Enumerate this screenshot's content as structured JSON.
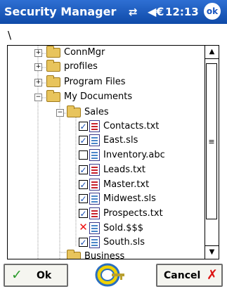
{
  "titlebar": {
    "title": "Security Manager",
    "signal_icon": "signal-icon",
    "volume_icon": "speaker-icon",
    "time": "12:13",
    "ok_label": "ok"
  },
  "path": "\\",
  "tree": {
    "items": [
      {
        "label": "ConnMgr",
        "type": "folder",
        "expander": "+"
      },
      {
        "label": "profiles",
        "type": "folder",
        "expander": "+"
      },
      {
        "label": "Program Files",
        "type": "folder",
        "expander": "+"
      },
      {
        "label": "My Documents",
        "type": "folder",
        "expander": "−"
      },
      {
        "label": "Sales",
        "type": "folder",
        "expander": "−"
      },
      {
        "label": "Contacts.txt",
        "type": "file",
        "check": "checked",
        "icon": "red"
      },
      {
        "label": "East.sls",
        "type": "file",
        "check": "checked",
        "icon": "multi"
      },
      {
        "label": "Inventory.abc",
        "type": "file",
        "check": "unchecked",
        "icon": "blue"
      },
      {
        "label": "Leads.txt",
        "type": "file",
        "check": "checked",
        "icon": "red"
      },
      {
        "label": "Master.txt",
        "type": "file",
        "check": "checked",
        "icon": "red"
      },
      {
        "label": "Midwest.sls",
        "type": "file",
        "check": "checked",
        "icon": "multi"
      },
      {
        "label": "Prospects.txt",
        "type": "file",
        "check": "checked",
        "icon": "red"
      },
      {
        "label": "Sold.$$$",
        "type": "file",
        "check": "denied",
        "icon": "blue"
      },
      {
        "label": "South.sls",
        "type": "file",
        "check": "checked",
        "icon": "multi"
      },
      {
        "label": "Business",
        "type": "folder"
      }
    ],
    "scrollbar": {
      "up_icon": "scroll-up-arrow-icon",
      "down_icon": "scroll-down-arrow-icon",
      "grip_icon": "grip-icon"
    }
  },
  "buttons": {
    "ok_label": "Ok",
    "cancel_label": "Cancel"
  },
  "colors": {
    "titlebar": "#1a56c0",
    "check": "#1a4fb3",
    "deny": "#e11111"
  }
}
